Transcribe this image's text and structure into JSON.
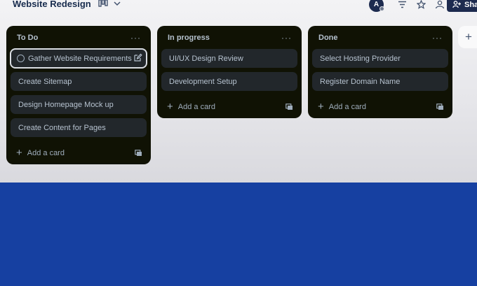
{
  "header": {
    "board_title": "Website Redesign",
    "view_icon": "board-view-icon",
    "avatar_initial": "A",
    "share_label": "Sha"
  },
  "lists": [
    {
      "title": "To Do",
      "cards": [
        "Gather Website Requirements",
        "Create Sitemap",
        "Design Homepage Mock up",
        "Create Content for Pages"
      ],
      "add_card": "Add a card"
    },
    {
      "title": "In progress",
      "cards": [
        "UI/UX Design Review",
        "Development Setup"
      ],
      "add_card": "Add a card"
    },
    {
      "title": "Done",
      "cards": [
        "Select Hosting Provider",
        "Register Domain Name"
      ],
      "add_card": "Add a card"
    }
  ],
  "colors": {
    "list_bg": "#101204",
    "card_bg": "#22272b",
    "bottom_band": "#1640a1"
  }
}
